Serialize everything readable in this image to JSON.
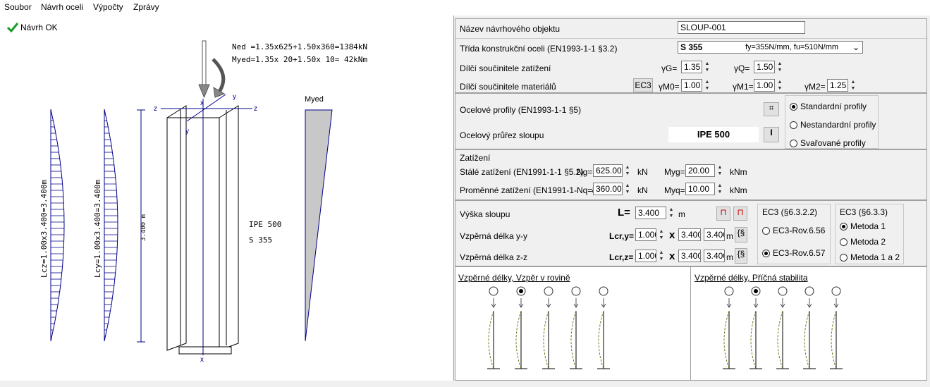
{
  "menu": [
    "Soubor",
    "Návrh oceli",
    "Výpočty",
    "Zprávy"
  ],
  "status": "Návrh OK",
  "drawing": {
    "ned_line": "Ned =1.35x625+1.50x360=1384kN",
    "myed_line": "Myed=1.35x 20+1.50x 10=  42kNm",
    "myed_label": "Myed",
    "lcz": "Lcz=1.00x3.400=3.400m",
    "lcy": "Lcy=1.00x3.400=3.400m",
    "height": "3.400 m",
    "profile": "IPE 500",
    "steel": "S 355",
    "axis_z": "z",
    "axis_y": "y",
    "axis_x": "x"
  },
  "form": {
    "name_label": "Název návrhového objektu",
    "name_value": "SLOUP-001",
    "class_label": "Třída konstrukční oceli (EN1993-1-1 §3.2)",
    "class_value": "S 355",
    "class_props": "fy=355N/mm, fu=510N/mm",
    "load_factors_label": "Dílčí součinitele zatížení",
    "gG_label": "γG=",
    "gG": "1.35",
    "gQ_label": "γQ=",
    "gQ": "1.50",
    "mat_factors_label": "Dílčí součinitele materiálů",
    "ec3_btn": "EC3",
    "gM0_label": "γM0=",
    "gM0": "1.00",
    "gM1_label": "γM1=",
    "gM1": "1.00",
    "gM2_label": "γM2=",
    "gM2": "1.25",
    "profiles_label": "Ocelové profily (EN1993-1-1 §5)",
    "section_label": "Ocelový průřez sloupu",
    "section_value": "IPE 500",
    "profile_types": [
      "Standardní profily",
      "Nestandardní profily",
      "Svařované profily"
    ],
    "loads_title": "Zatížení",
    "perm_label": "Stálé zatížení (EN1991-1-1 §5.2)",
    "ng_label": "Ng=",
    "ng": "625.00",
    "kn": "kN",
    "myg_label": "Myg=",
    "myg": "20.00",
    "knm": "kNm",
    "var_label": "Proměnné zatížení (EN1991-1-1 §6)",
    "nq_label": "Nq=",
    "nq": "360.00",
    "myq_label": "Myq=",
    "myq": "10.00",
    "height_label": "Výška sloupu",
    "L_label": "L=",
    "L": "3.400",
    "m": "m",
    "lcry_label": "Vzpěrná délka y-y",
    "lcry_sym": "Lcr,y=",
    "lcry_factor": "1.000",
    "lcry_len": "3.400",
    "lcry_res": "3.400",
    "lcrz_label": "Vzpěrná délka z-z",
    "lcrz_sym": "Lcr,z=",
    "lcrz_factor": "1.000",
    "lcrz_len": "3.400",
    "lcrz_res": "3.400",
    "times": "x",
    "ec3_322_title": "EC3 (§6.3.2.2)",
    "ec3_322_opts": [
      "EC3-Rov.6.56",
      "EC3-Rov.6.57"
    ],
    "ec3_633_title": "EC3 (§6.3.3)",
    "ec3_633_opts": [
      "Metoda 1",
      "Metoda 2",
      "Metoda 1 a 2"
    ],
    "buck_in_plane": "Vzpěrné délky, Vzpěr v rovině",
    "buck_lateral": "Vzpěrné délky, Příčná stabilita"
  }
}
